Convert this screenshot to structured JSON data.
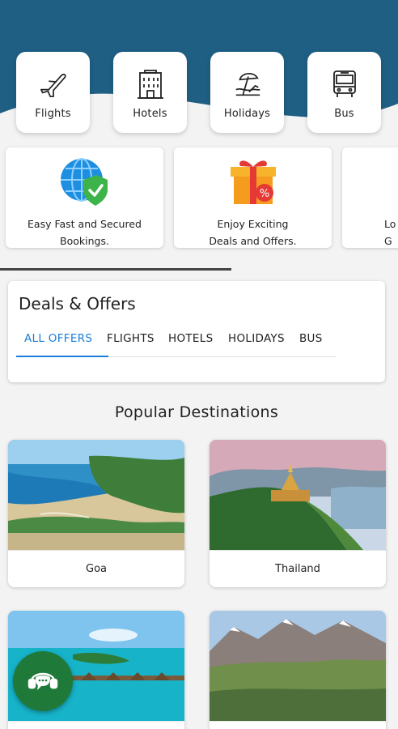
{
  "colors": {
    "header": "#1f5f84",
    "accent": "#1a7fd6",
    "fab": "#1f7a3a"
  },
  "categories": [
    {
      "label": "Flights",
      "icon": "airplane-icon"
    },
    {
      "label": "Hotels",
      "icon": "hotel-building-icon"
    },
    {
      "label": "Holidays",
      "icon": "beach-umbrella-icon"
    },
    {
      "label": "Bus",
      "icon": "bus-icon"
    }
  ],
  "features": [
    {
      "line1": "Easy Fast and Secured",
      "line2": "Bookings.",
      "icon": "secure-globe-icon"
    },
    {
      "line1": "Enjoy Exciting",
      "line2": "Deals and Offers.",
      "icon": "gift-discount-icon"
    },
    {
      "line1": "Lo",
      "line2": "G",
      "icon": ""
    }
  ],
  "deals": {
    "title": "Deals & Offers",
    "tabs": [
      "ALL OFFERS",
      "FLIGHTS",
      "HOTELS",
      "HOLIDAYS",
      "BUS"
    ],
    "active_tab": "ALL OFFERS"
  },
  "popular": {
    "title": "Popular Destinations",
    "destinations": [
      {
        "name": "Goa"
      },
      {
        "name": "Thailand"
      },
      {
        "name": ""
      },
      {
        "name": ""
      }
    ]
  },
  "chat": {
    "icon": "chat-support-icon"
  }
}
